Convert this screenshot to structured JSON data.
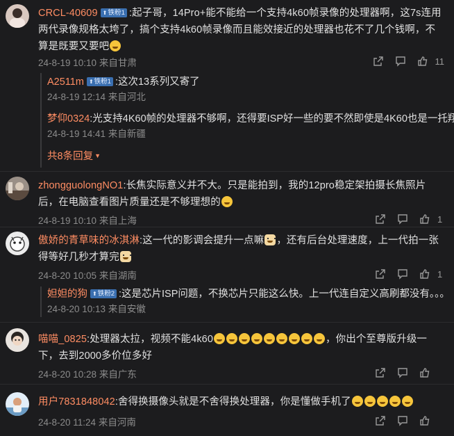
{
  "comments": [
    {
      "username": "CRCL-40609",
      "badge": "铁粉1",
      "text": ":起子哥，14Pro+能不能给一个支持4k60帧录像的处理器啊，这7s连用两代录像规格太垮了，搞个支持4k60帧录像而且能效接近的处理器也花不了几个钱啊，不算是既要又要吧",
      "meta": "24-8-19 10:10 来自甘肃",
      "likes": "11",
      "replies": [
        {
          "username": "A2511m",
          "badge": "铁粉1",
          "text": ":这次13系列又寄了",
          "meta": "24-8-19 12:14 来自河北"
        },
        {
          "username": "梦仰0324",
          "badge": "",
          "text": ":光支持4K60帧的处理器不够啊，还得要ISP好一些的要不然即使是4K60也是一托翔",
          "meta": "24-8-19 14:41 来自新疆"
        }
      ],
      "more": "共8条回复"
    },
    {
      "username": "zhongguolongNO1",
      "text": ":长焦实际意义并不大。只是能拍到，我的12pro稳定架拍摄长焦照片后，在电脑查看图片质量还是不够理想的",
      "meta": "24-8-19 10:10 来自上海",
      "likes": "1"
    },
    {
      "username": "傲娇的青草味的冰淇淋",
      "text": ":这一代的影调会提升一点嘛",
      "text2": "，还有后台处理速度，上一代拍一张得等好几秒才算完",
      "meta": "24-8-20 10:05 来自湖南",
      "likes": "1",
      "replies": [
        {
          "username": "妲妲的狗",
          "badge": "铁粉2",
          "text": ":这是芯片ISP问题，不换芯片只能这么快。上一代连自定义高刷都没有。。。",
          "meta": "24-8-20 10:13 来自安徽"
        }
      ]
    },
    {
      "username": "喵喵_0825",
      "text": ":处理器太拉，视频不能4k60",
      "text2": "，你出个至尊版升级一下，去到2000多价位多好",
      "meta": "24-8-20 10:28 来自广东",
      "likes": ""
    },
    {
      "username": "用户7831848042",
      "text": ":舍得换摄像头就是不舍得换处理器，你是懂做手机了",
      "meta": "24-8-20 11:24 来自河南",
      "likes": ""
    }
  ],
  "colors": {
    "background": "#1c1c1e",
    "username": "#ff8d63",
    "badge": "#3a6fb0",
    "meta": "#8b8b8b"
  },
  "icons": [
    "share-icon",
    "comment-icon",
    "like-icon",
    "badge-up-icon",
    "emoji"
  ]
}
